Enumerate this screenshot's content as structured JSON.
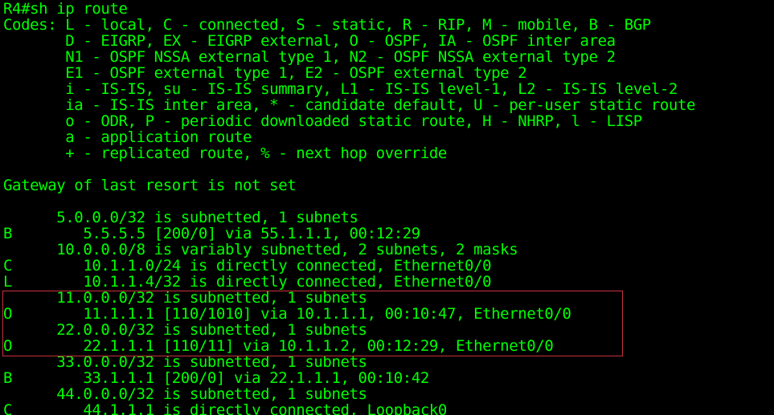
{
  "terminal": {
    "text_color": "#00ff00",
    "background_color": "#000000",
    "highlight_color": "#c8323c",
    "lines": [
      "R4#sh ip route",
      "Codes: L - local, C - connected, S - static, R - RIP, M - mobile, B - BGP",
      "       D - EIGRP, EX - EIGRP external, O - OSPF, IA - OSPF inter area",
      "       N1 - OSPF NSSA external type 1, N2 - OSPF NSSA external type 2",
      "       E1 - OSPF external type 1, E2 - OSPF external type 2",
      "       i - IS-IS, su - IS-IS summary, L1 - IS-IS level-1, L2 - IS-IS level-2",
      "       ia - IS-IS inter area, * - candidate default, U - per-user static route",
      "       o - ODR, P - periodic downloaded static route, H - NHRP, l - LISP",
      "       a - application route",
      "       + - replicated route, % - next hop override",
      "",
      "Gateway of last resort is not set",
      "",
      "      5.0.0.0/32 is subnetted, 1 subnets",
      "B        5.5.5.5 [200/0] via 55.1.1.1, 00:12:29",
      "      10.0.0.0/8 is variably subnetted, 2 subnets, 2 masks",
      "C        10.1.1.0/24 is directly connected, Ethernet0/0",
      "L        10.1.1.4/32 is directly connected, Ethernet0/0",
      "      11.0.0.0/32 is subnetted, 1 subnets",
      "O        11.1.1.1 [110/1010] via 10.1.1.1, 00:10:47, Ethernet0/0",
      "      22.0.0.0/32 is subnetted, 1 subnets",
      "O        22.1.1.1 [110/11] via 10.1.1.2, 00:12:29, Ethernet0/0",
      "      33.0.0.0/32 is subnetted, 1 subnets",
      "B        33.1.1.1 [200/0] via 22.1.1.1, 00:10:42",
      "      44.0.0.0/32 is subnetted, 1 subnets",
      "C        44.1.1.1 is directly connected, Loopback0"
    ]
  }
}
